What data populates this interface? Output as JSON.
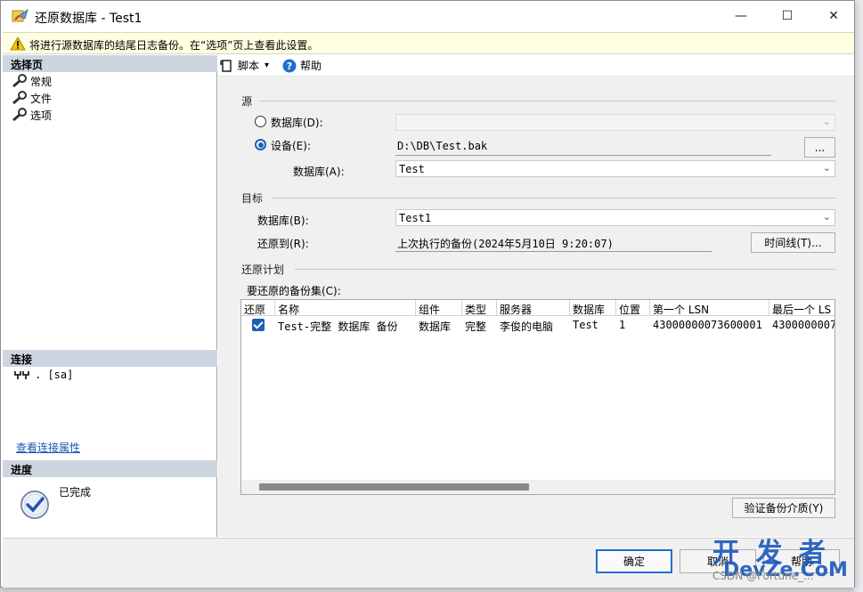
{
  "window": {
    "title": "还原数据库 - Test1",
    "min": "—",
    "max": "☐",
    "close": "✕"
  },
  "warning": "将进行源数据库的结尾日志备份。在“选项”页上查看此设置。",
  "left": {
    "select_page_header": "选择页",
    "pages": [
      "常规",
      "文件",
      "选项"
    ],
    "connection_header": "连接",
    "connection_value": ". [sa]",
    "view_connection_link": "查看连接属性",
    "progress_header": "进度",
    "progress_status": "已完成"
  },
  "toolbar": {
    "script": "脚本",
    "script_arrow": "▾",
    "help": "帮助"
  },
  "source": {
    "group_label": "源",
    "database_option": "数据库(D):",
    "device_option": "设备(E):",
    "device_path": "D:\\DB\\Test.bak",
    "browse_label": "...",
    "database_label": "数据库(A):",
    "database_value": "Test"
  },
  "target": {
    "group_label": "目标",
    "database_label": "数据库(B):",
    "database_value": "Test1",
    "restore_to_label": "还原到(R):",
    "restore_to_value": "上次执行的备份(2024年5月10日 9:20:07)",
    "timeline_button": "时间线(T)..."
  },
  "plan": {
    "group_label": "还原计划",
    "backup_sets_label": "要还原的备份集(C):",
    "columns": [
      "还原",
      "名称",
      "组件",
      "类型",
      "服务器",
      "数据库",
      "位置",
      "第一个 LSN",
      "最后一个 LS"
    ],
    "rows": [
      {
        "restore": true,
        "name": "Test-完整 数据库 备份",
        "component": "数据库",
        "type": "完整",
        "server": "李俊的电脑",
        "database": "Test",
        "position": "1",
        "first_lsn": "43000000073600001",
        "last_lsn": "4300000007"
      }
    ],
    "verify_button": "验证备份介质(Y)"
  },
  "buttons": {
    "ok": "确定",
    "cancel": "取消",
    "help": "帮助"
  },
  "watermark": {
    "line1": "开 发 者",
    "line2": "DevZe.CoM",
    "line3": "CSDN @Fortune_..."
  }
}
